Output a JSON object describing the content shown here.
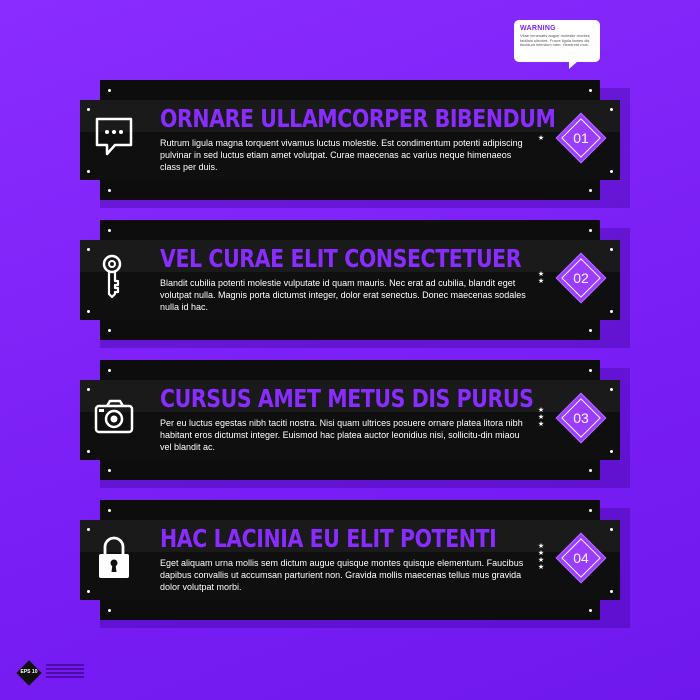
{
  "warning": {
    "title": "WARNING",
    "text": "Vitae venenatis augue molestie montes facilisis ultricies. Fusce ligula fames dis tincidunt interdum nam. Hendrerit mus."
  },
  "cards": [
    {
      "title": "ORNARE ULLAMCORPER BIBENDUM",
      "text": "Rutrum ligula magna torquent vivamus luctus molestie. Est condimentum potenti adipiscing pulvinar in sed luctus etiam amet volutpat. Curae maecenas ac varius neque himenaeos class per duis.",
      "number": "01",
      "stars": 1,
      "icon": "chat-bubble-icon"
    },
    {
      "title": "VEL CURAE ELIT CONSECTETUER",
      "text": "Blandit cubilia potenti molestie vulputate id quam mauris. Nec erat ad cubilia, blandit eget volutpat nulla. Magnis porta dictumst integer, dolor erat senectus. Donec maecenas sodales nulla id hac.",
      "number": "02",
      "stars": 2,
      "icon": "key-icon"
    },
    {
      "title": "CURSUS AMET METUS DIS PURUS",
      "text": "Per eu luctus egestas nibh taciti nostra. Nisi quam ultrices posuere ornare platea litora nibh habitant eros dictumst integer. Euismod hac platea auctor leonidius nisi, sollicitu-din miaou vel blandit ac.",
      "number": "03",
      "stars": 3,
      "icon": "camera-icon"
    },
    {
      "title": "HAC LACINIA EU ELIT POTENTI",
      "text": "Eget aliquam urna mollis sem dictum augue quisque montes quisque elementum. Faucibus dapibus convallis ut accumsan parturient non. Gravida mollis maecenas tellus mus gravida dolor volutpat morbi.",
      "number": "04",
      "stars": 4,
      "icon": "padlock-icon"
    }
  ],
  "badge": {
    "text": "EPS 10"
  },
  "colors": {
    "background": "#7a1ff5",
    "accent": "#8a2cff",
    "card": "#1a1a1a",
    "diamond": "#9b3cff"
  }
}
